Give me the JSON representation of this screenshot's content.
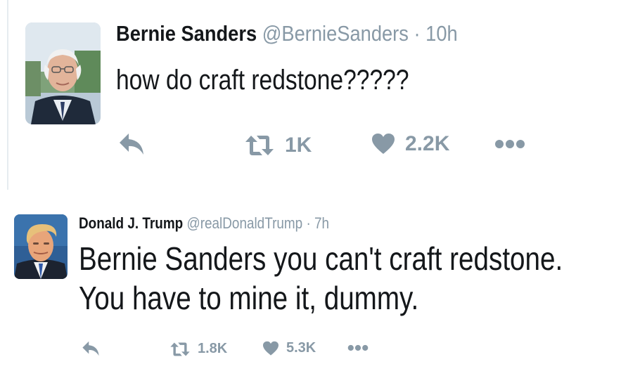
{
  "tweets": [
    {
      "display_name": "Bernie Sanders",
      "handle": "@BernieSanders",
      "separator": "·",
      "time": "10h",
      "text_lines": [
        "how do craft redstone?????"
      ],
      "retweets": "1K",
      "likes": "2.2K",
      "avatar_icon": "avatar-photo",
      "reply_icon": "reply-icon",
      "retweet_icon": "retweet-icon",
      "like_icon": "heart-icon",
      "more_icon": "more-dots-icon"
    },
    {
      "display_name": "Donald J. Trump",
      "handle": "@realDonaldTrump",
      "separator": "·",
      "time": "7h",
      "text_lines": [
        "Bernie Sanders you can't craft redstone.",
        "You have to mine it, dummy."
      ],
      "retweets": "1.8K",
      "likes": "5.3K",
      "avatar_icon": "avatar-photo",
      "reply_icon": "reply-icon",
      "retweet_icon": "retweet-icon",
      "like_icon": "heart-icon",
      "more_icon": "more-dots-icon"
    }
  ],
  "colors": {
    "text": "#14171a",
    "muted": "#8899a6",
    "divider": "#e6ecf0"
  }
}
